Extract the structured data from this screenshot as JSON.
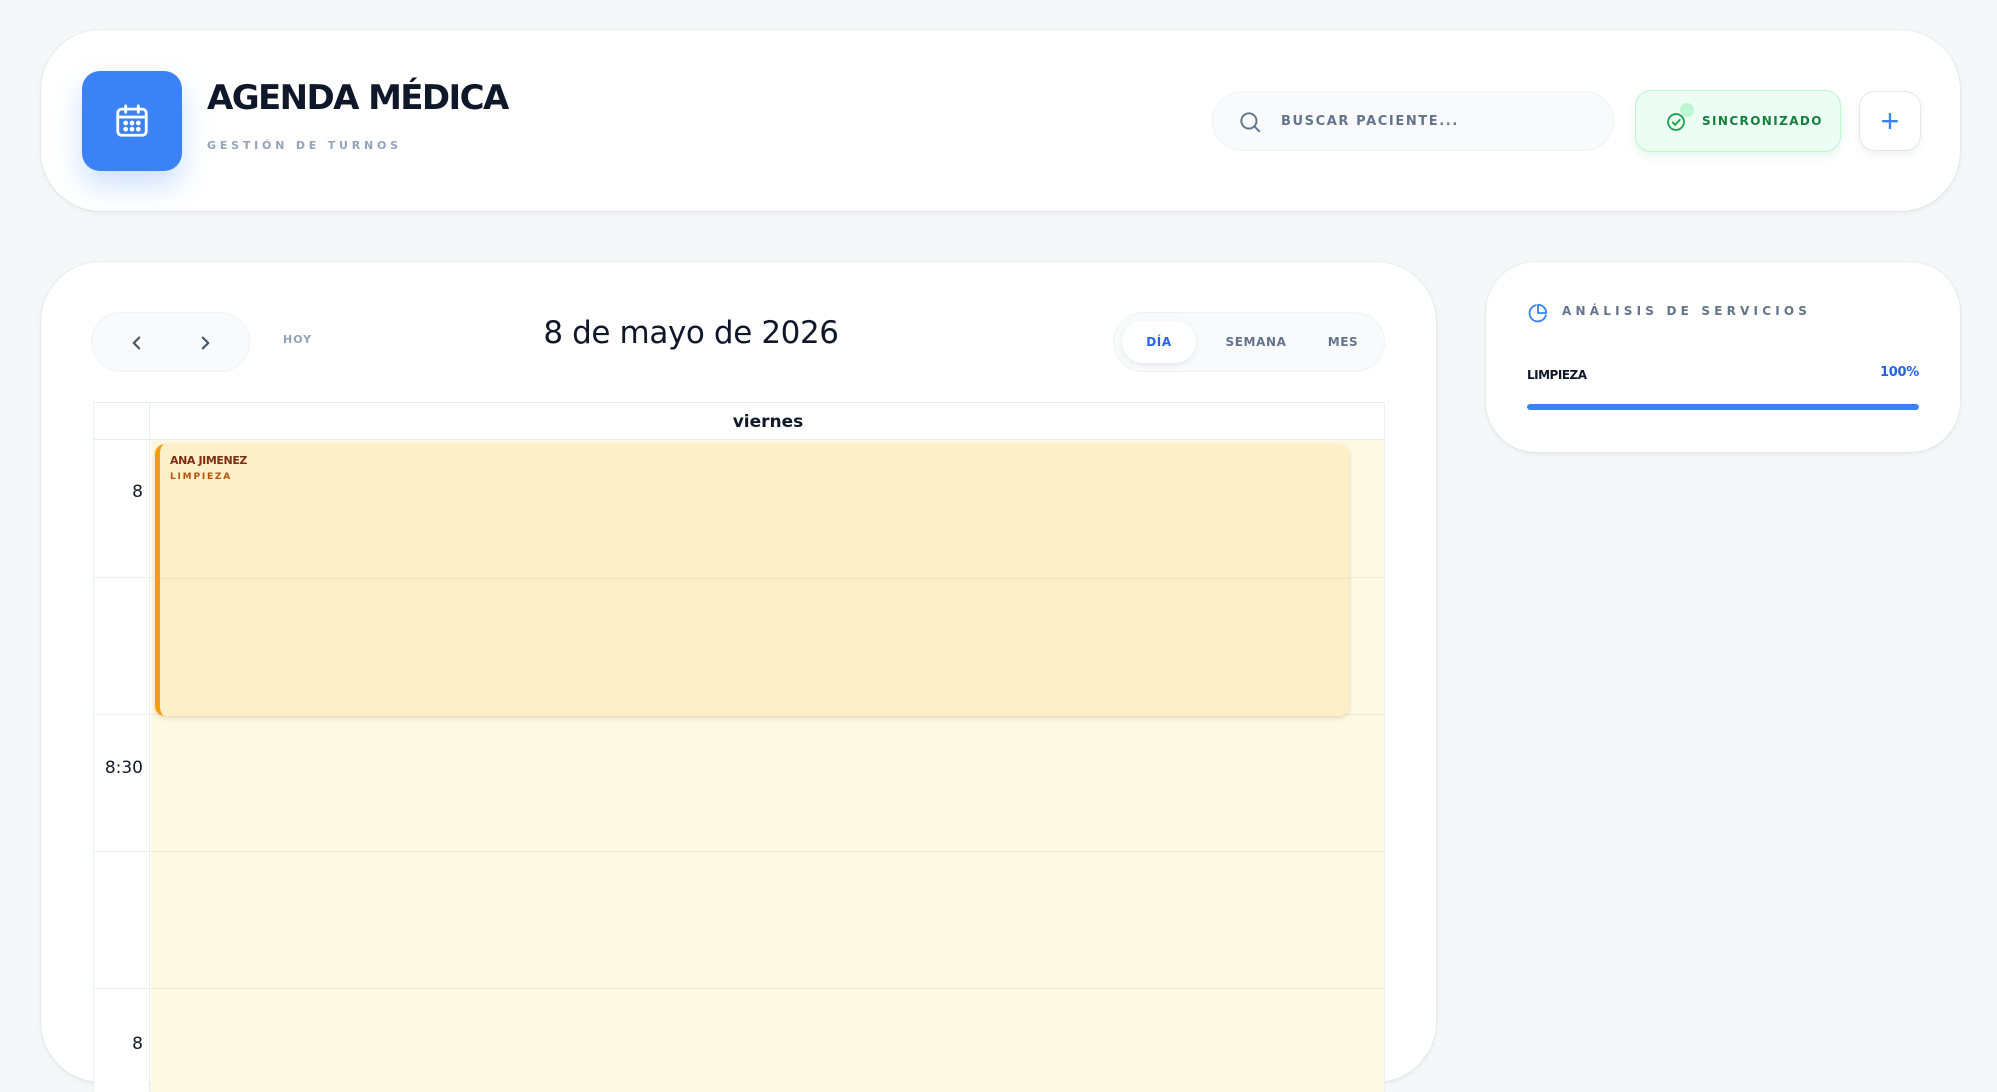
{
  "header": {
    "title": "AGENDA MÉDICA",
    "subtitle": "GESTIÓN DE TURNOS",
    "logo_icon": "calendar-icon",
    "search": {
      "placeholder": "BUSCAR PACIENTE...",
      "value": "",
      "icon": "search-icon"
    },
    "sync": {
      "label": "SINCRONIZADO",
      "icon": "check-circle-icon"
    },
    "add_button": {
      "label": "+",
      "icon": "plus-icon"
    }
  },
  "calendar": {
    "nav": {
      "prev_icon": "chevron-left-icon",
      "next_icon": "chevron-right-icon"
    },
    "today_label": "HOY",
    "date_title": "8 de mayo de 2026",
    "views": [
      {
        "label": "DÍA",
        "active": true
      },
      {
        "label": "SEMANA",
        "active": false
      },
      {
        "label": "MES",
        "active": false
      }
    ],
    "day_name": "viernes",
    "time_labels": [
      "8",
      "8:30",
      "8"
    ],
    "events": [
      {
        "patient": "ANA JIMENEZ",
        "service": "LIMPIEZA"
      }
    ]
  },
  "analysis": {
    "title": "ANÁLISIS DE SERVICIOS",
    "icon": "pie-chart-icon",
    "services": [
      {
        "name": "LIMPIEZA",
        "percent_label": "100%",
        "fraction": 1.0
      }
    ]
  },
  "colors": {
    "accent": "#3b82f6",
    "sync_green": "#15803d",
    "event_border": "#f59e0b",
    "event_bg": "#fdefc8",
    "day_bg": "#fef9e3"
  }
}
